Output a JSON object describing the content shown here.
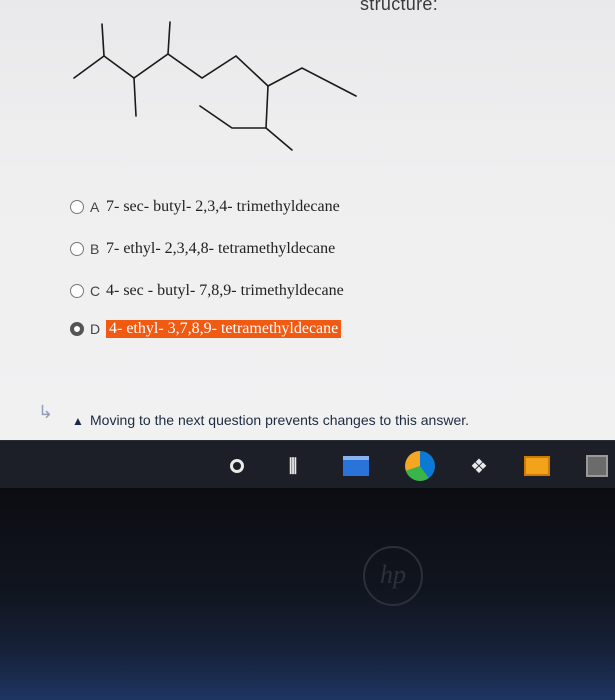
{
  "question": {
    "title": "structure:"
  },
  "options": [
    {
      "letter": "A",
      "text": "7- sec- butyl- 2,3,4- trimethyldecane",
      "selected": false
    },
    {
      "letter": "B",
      "text": "7- ethyl- 2,3,4,8- tetramethyldecane",
      "selected": false
    },
    {
      "letter": "C",
      "text": "4- sec - butyl- 7,8,9- trimethyldecane",
      "selected": false
    },
    {
      "letter": "D",
      "text": "4- ethyl- 3,7,8,9- tetramethyldecane",
      "selected": true
    }
  ],
  "warning": {
    "text": "Moving to the next question prevents changes to this answer."
  },
  "taskbar": {
    "icons": [
      "search-icon",
      "task-view-icon",
      "file-explorer-icon",
      "edge-browser-icon",
      "dropbox-icon",
      "mail-icon",
      "store-icon"
    ]
  },
  "device": {
    "logo": "hp"
  },
  "colors": {
    "highlight": "#f05a12",
    "taskbar": "#1c1f27"
  }
}
